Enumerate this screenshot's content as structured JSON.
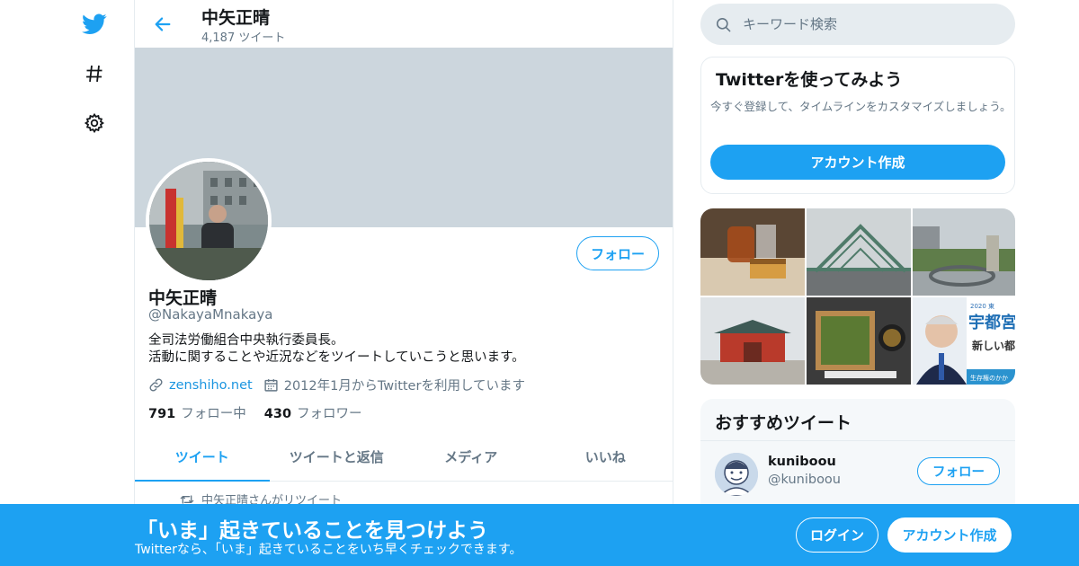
{
  "nav": {
    "icons": [
      "twitter-bird-icon",
      "hashtag-icon",
      "gear-icon"
    ],
    "brand_color": "#1da1f2"
  },
  "header": {
    "name": "中矢正晴",
    "tweet_count": "4,187 ツイート"
  },
  "profile": {
    "name": "中矢正晴",
    "handle": "@NakayaMnakaya",
    "bio_line1": "全司法労働組合中央執行委員長。",
    "bio_line2": "活動に関することや近況などをツイートしていこうと思います。",
    "website": "zenshiho.net",
    "joined": "2012年1月からTwitterを利用しています",
    "following_count": "791",
    "following_label": "フォロー中",
    "followers_count": "430",
    "followers_label": "フォロワー",
    "follow_button": "フォロー"
  },
  "tabs": [
    {
      "label": "ツイート",
      "active": true
    },
    {
      "label": "ツイートと返信",
      "active": false
    },
    {
      "label": "メディア",
      "active": false
    },
    {
      "label": "いいね",
      "active": false
    }
  ],
  "timeline": {
    "retweet_notice": "中矢正晴さんがリツイート"
  },
  "search": {
    "placeholder": "キーワード検索"
  },
  "signup_card": {
    "title": "Twitterを使ってみよう",
    "description": "今すぐ登録して、タイムラインをカスタマイズしましょう。",
    "button": "アカウント作成"
  },
  "media_thumbs": {
    "poster_year_label": "2020 東",
    "poster_title": "宇都宮",
    "poster_sub": "新しい都",
    "poster_footer": "生存権のかか"
  },
  "recommended": {
    "title": "おすすめツイート",
    "user_name": "kuniboou",
    "user_handle": "@kuniboou",
    "follow_button": "フォロー"
  },
  "bottom_bar": {
    "title": "「いま」起きていることを見つけよう",
    "subtitle": "Twitterなら、「いま」起きていることをいち早くチェックできます。",
    "login": "ログイン",
    "signup": "アカウント作成"
  }
}
